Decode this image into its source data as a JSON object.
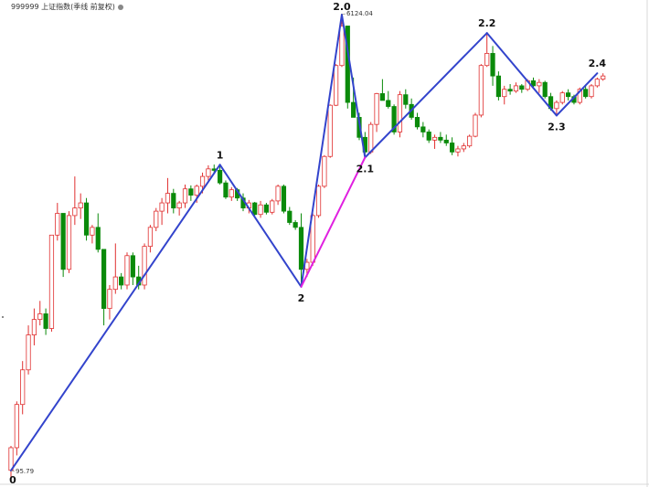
{
  "header": {
    "title": "999999 上证指数(季线 前复权)",
    "indicator_icon": "circle-dot-icon"
  },
  "colors": {
    "up": "#e03030",
    "down": "#0a8a0a",
    "wave": "#3344cc",
    "wave_alt": "#e020e0",
    "axis": "#d8d8d8"
  },
  "chart_data": {
    "type": "candlestick",
    "title": "999999 上证指数(季线 前复权)",
    "price_labels": [
      {
        "text": "95.79",
        "value": 95.79,
        "index": 0
      },
      {
        "text": "6124.04",
        "value": 6124.04,
        "index": 57
      }
    ],
    "wave_points": [
      {
        "label": "0",
        "index": 0,
        "value": 95.8
      },
      {
        "label": "1",
        "index": 36,
        "value": 1558
      },
      {
        "label": "2",
        "index": 50,
        "value": 512
      },
      {
        "label": "2.0",
        "index": 57,
        "value": 6124
      },
      {
        "label": "2.1",
        "index": 61,
        "value": 1664
      },
      {
        "label": "2.2",
        "index": 82,
        "value": 5178
      },
      {
        "label": "2.3",
        "index": 94,
        "value": 2440
      },
      {
        "label": "2.4",
        "index": 101,
        "value": 3587
      }
    ],
    "wave_alt_segments": [
      [
        2,
        4
      ]
    ],
    "candles": [
      [
        96,
        120,
        90,
        118
      ],
      [
        118,
        180,
        110,
        175
      ],
      [
        175,
        260,
        160,
        240
      ],
      [
        240,
        360,
        230,
        330
      ],
      [
        330,
        420,
        300,
        380
      ],
      [
        380,
        450,
        360,
        400
      ],
      [
        400,
        420,
        330,
        350
      ],
      [
        350,
        820,
        340,
        820
      ],
      [
        820,
        1100,
        780,
        1000
      ],
      [
        1000,
        980,
        560,
        600
      ],
      [
        600,
        1020,
        580,
        980
      ],
      [
        980,
        1400,
        900,
        1050
      ],
      [
        1050,
        1200,
        950,
        1100
      ],
      [
        1100,
        1150,
        780,
        820
      ],
      [
        820,
        900,
        760,
        880
      ],
      [
        880,
        1000,
        700,
        720
      ],
      [
        720,
        720,
        360,
        420
      ],
      [
        420,
        520,
        380,
        500
      ],
      [
        500,
        760,
        480,
        560
      ],
      [
        560,
        580,
        500,
        520
      ],
      [
        520,
        700,
        500,
        680
      ],
      [
        680,
        700,
        520,
        560
      ],
      [
        560,
        620,
        500,
        520
      ],
      [
        520,
        760,
        500,
        740
      ],
      [
        740,
        900,
        700,
        880
      ],
      [
        880,
        1050,
        850,
        1020
      ],
      [
        1020,
        1150,
        900,
        1100
      ],
      [
        1100,
        1380,
        1000,
        1200
      ],
      [
        1200,
        1250,
        1000,
        1050
      ],
      [
        1050,
        1120,
        980,
        1100
      ],
      [
        1100,
        1300,
        1050,
        1250
      ],
      [
        1250,
        1290,
        1120,
        1180
      ],
      [
        1180,
        1300,
        1100,
        1280
      ],
      [
        1280,
        1450,
        1200,
        1400
      ],
      [
        1400,
        1550,
        1350,
        1500
      ],
      [
        1500,
        1560,
        1440,
        1480
      ],
      [
        1480,
        1558,
        1300,
        1320
      ],
      [
        1320,
        1350,
        1140,
        1160
      ],
      [
        1160,
        1270,
        1120,
        1240
      ],
      [
        1240,
        1260,
        1120,
        1150
      ],
      [
        1150,
        1200,
        1020,
        1050
      ],
      [
        1050,
        1130,
        1000,
        1100
      ],
      [
        1100,
        1110,
        980,
        990
      ],
      [
        990,
        1120,
        960,
        1080
      ],
      [
        1080,
        1100,
        990,
        1010
      ],
      [
        1010,
        1140,
        990,
        1120
      ],
      [
        1120,
        1300,
        1080,
        1280
      ],
      [
        1280,
        1300,
        1000,
        1020
      ],
      [
        1020,
        1060,
        900,
        920
      ],
      [
        920,
        940,
        860,
        880
      ],
      [
        880,
        1000,
        512,
        600
      ],
      [
        600,
        660,
        560,
        640
      ],
      [
        640,
        1000,
        620,
        980
      ],
      [
        980,
        1300,
        960,
        1280
      ],
      [
        1280,
        1700,
        1260,
        1680
      ],
      [
        1680,
        2700,
        1660,
        2680
      ],
      [
        2680,
        3900,
        2660,
        3850
      ],
      [
        3850,
        6124,
        3800,
        5520
      ],
      [
        5520,
        5500,
        2600,
        2750
      ],
      [
        2750,
        3450,
        2650,
        2400
      ],
      [
        2400,
        2500,
        1950,
        2000
      ],
      [
        2000,
        2100,
        1664,
        1750
      ],
      [
        1750,
        2300,
        1720,
        2250
      ],
      [
        2250,
        3000,
        2100,
        2980
      ],
      [
        2980,
        3400,
        2850,
        2800
      ],
      [
        2800,
        3050,
        2600,
        2650
      ],
      [
        2650,
        2700,
        2050,
        2100
      ],
      [
        2100,
        3050,
        2000,
        2950
      ],
      [
        2950,
        3100,
        2600,
        2700
      ],
      [
        2700,
        2850,
        2350,
        2400
      ],
      [
        2400,
        2500,
        2150,
        2200
      ],
      [
        2200,
        2300,
        2000,
        2100
      ],
      [
        2100,
        2150,
        1900,
        1950
      ],
      [
        1950,
        2050,
        1800,
        2000
      ],
      [
        2000,
        2100,
        1900,
        1950
      ],
      [
        1950,
        2050,
        1850,
        1900
      ],
      [
        1900,
        2000,
        1700,
        1750
      ],
      [
        1750,
        1850,
        1680,
        1800
      ],
      [
        1800,
        1900,
        1750,
        1850
      ],
      [
        1850,
        2050,
        1820,
        2020
      ],
      [
        2020,
        2500,
        2000,
        2450
      ],
      [
        2450,
        3900,
        2400,
        3850
      ],
      [
        3850,
        5178,
        3800,
        4300
      ],
      [
        4300,
        4600,
        3200,
        3500
      ],
      [
        3500,
        3650,
        2800,
        2900
      ],
      [
        2900,
        3200,
        2700,
        3100
      ],
      [
        3100,
        3250,
        2950,
        3050
      ],
      [
        3050,
        3300,
        3000,
        3200
      ],
      [
        3200,
        3250,
        3000,
        3100
      ],
      [
        3100,
        3400,
        3050,
        3350
      ],
      [
        3350,
        3450,
        3150,
        3200
      ],
      [
        3200,
        3400,
        3000,
        3300
      ],
      [
        3300,
        3350,
        2850,
        2900
      ],
      [
        2900,
        3000,
        2550,
        2600
      ],
      [
        2600,
        2800,
        2440,
        2750
      ],
      [
        2750,
        3050,
        2700,
        3000
      ],
      [
        3000,
        3100,
        2800,
        2900
      ],
      [
        2900,
        2950,
        2700,
        2750
      ],
      [
        2750,
        3150,
        2700,
        3100
      ],
      [
        3100,
        3200,
        2850,
        2900
      ],
      [
        2900,
        3250,
        2850,
        3200
      ],
      [
        3200,
        3450,
        3150,
        3400
      ],
      [
        3400,
        3587,
        3350,
        3500
      ]
    ],
    "candle_order": [
      "open",
      "high",
      "low",
      "close"
    ],
    "grid": false,
    "legend": "none"
  }
}
